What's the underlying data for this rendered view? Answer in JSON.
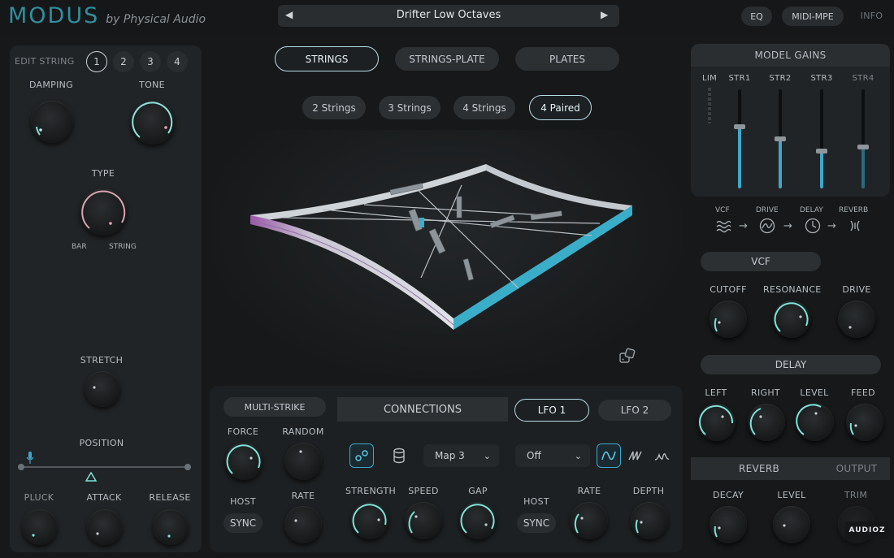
{
  "header": {
    "brand": "MODUS",
    "brand_sub": "by Physical Audio",
    "preset_name": "Drifter Low Octaves",
    "prev_label": "◀",
    "next_label": "▶",
    "nav": [
      "EQ",
      "MIDI-MPE",
      "INFO"
    ]
  },
  "left": {
    "edit_string_label": "EDIT STRING",
    "string_numbers": [
      "1",
      "2",
      "3",
      "4"
    ],
    "damping": "DAMPING",
    "tone": "TONE",
    "type": "TYPE",
    "type_min": "BAR",
    "type_max": "STRING",
    "stretch": "STRETCH",
    "position": "POSITION",
    "pluck": "PLUCK",
    "attack": "ATTACK",
    "release": "RELEASE"
  },
  "center": {
    "model_tabs": [
      "STRINGS",
      "STRINGS-PLATE",
      "PLATES"
    ],
    "string_modes": [
      "2 Strings",
      "3 Strings",
      "4 Strings",
      "4 Paired"
    ],
    "multi_strike": "MULTI-STRIKE",
    "force": "FORCE",
    "random": "RANDOM",
    "host": "HOST",
    "sync": "SYNC",
    "rate": "RATE",
    "connections": "CONNECTIONS",
    "map_value": "Map 3",
    "strength": "STRENGTH",
    "speed": "SPEED",
    "gap": "GAP",
    "lfo1": "LFO 1",
    "lfo2": "LFO 2",
    "lfo_off": "Off",
    "lfo_host": "HOST",
    "lfo_sync": "SYNC",
    "lfo_rate": "RATE",
    "lfo_depth": "DEPTH"
  },
  "right": {
    "model_gains": "MODEL GAINS",
    "lim": "LIM",
    "strings": [
      "STR1",
      "STR2",
      "STR3",
      "STR4"
    ],
    "fader_levels": [
      0.62,
      0.5,
      0.38,
      0.42
    ],
    "chain": [
      "VCF",
      "DRIVE",
      "DELAY",
      "REVERB"
    ],
    "vcf": "VCF",
    "cutoff": "CUTOFF",
    "resonance": "RESONANCE",
    "drive": "DRIVE",
    "delay": "DELAY",
    "left": "LEFT",
    "right": "RIGHT",
    "level": "LEVEL",
    "feed": "FEED",
    "reverb": "REVERB",
    "output": "OUTPUT",
    "decay": "DECAY",
    "rev_level": "LEVEL",
    "trim": "TRIM"
  },
  "watermark": "AUDIOZ",
  "colors": {
    "accent": "#3fa7c9",
    "accent_glow": "#7de3d8",
    "pink": "#e58ea0"
  }
}
